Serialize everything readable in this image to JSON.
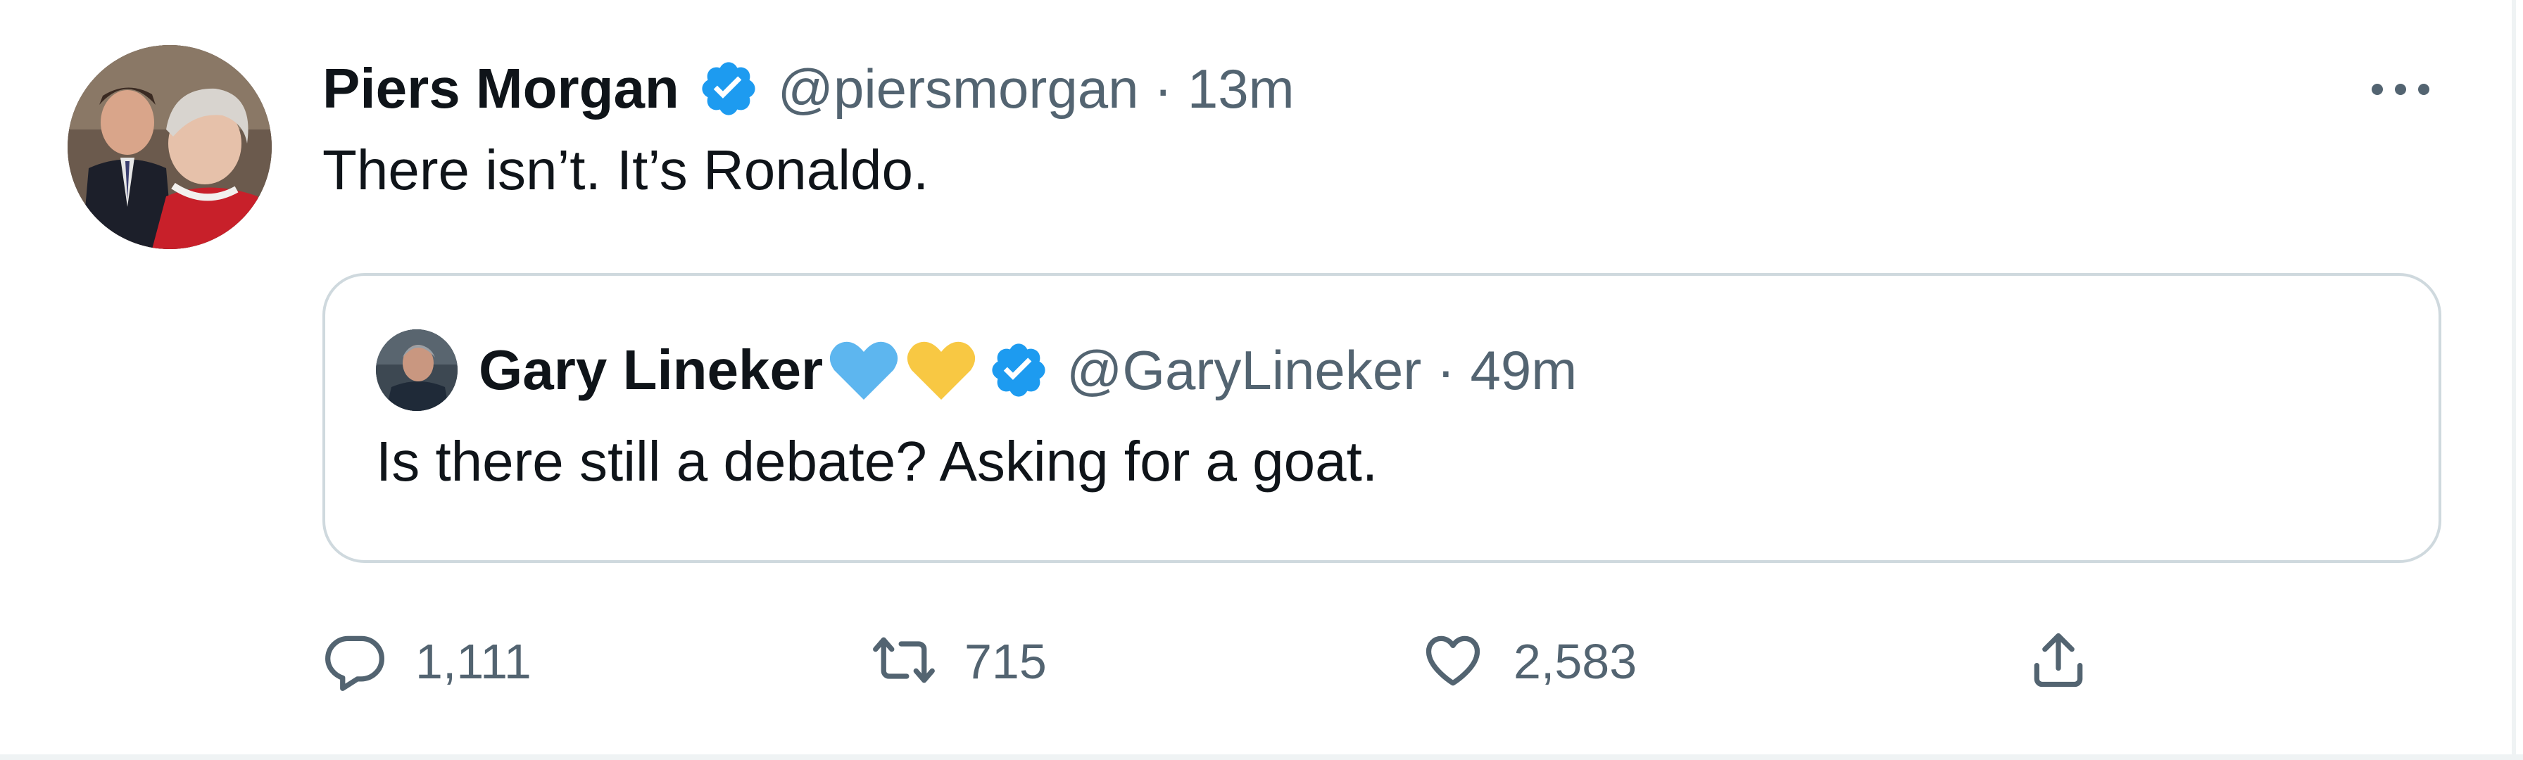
{
  "tweet": {
    "author_name": "Piers Morgan",
    "author_handle": "@piersmorgan",
    "separator": "·",
    "time": "13m",
    "text": "There isn’t. It’s Ronaldo.",
    "more_label": "···"
  },
  "quoted_tweet": {
    "author_name": "Gary Lineker",
    "author_handle": "@GaryLineker",
    "separator": "·",
    "time": "49m",
    "text": "Is there still a debate? Asking for a goat.",
    "emojis": [
      "blue-heart-emoji",
      "yellow-heart-emoji"
    ]
  },
  "actions": {
    "replies": "1,111",
    "retweets": "715",
    "likes": "2,583"
  },
  "colors": {
    "verified_blue": "#1d9bf0",
    "text_primary": "#0f1419",
    "text_secondary": "#536471",
    "border": "#cfd9de",
    "blue_heart": "#5db6ef",
    "yellow_heart": "#f8c843"
  },
  "icons": {
    "verified": "verified-badge-icon",
    "reply": "reply-icon",
    "retweet": "retweet-icon",
    "like": "heart-icon",
    "share": "share-icon",
    "more": "more-options-icon"
  }
}
